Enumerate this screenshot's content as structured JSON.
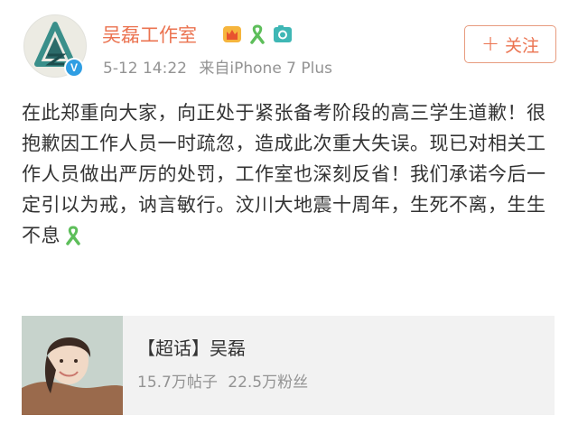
{
  "post": {
    "author": "吴磊工作室",
    "time": "5-12 14:22",
    "source": "来自iPhone 7 Plus",
    "follow_label": "关注",
    "follow_icon": "plus-icon",
    "content": "在此郑重向大家，向正处于紧张备考阶段的高三学生道歉！很抱歉因工作人员一时疏忽，造成此次重大失误。现已对相关工作人员做出严厉的处罚，工作室也深刻反省！我们承诺今后一定引以为戒，讷言敏行。汶川大地震十周年，生死不离，生生不息",
    "badges": [
      "crown-icon",
      "green-ribbon-icon",
      "camera-icon"
    ],
    "verified_mark": "V",
    "colors": {
      "accent": "#eb7350",
      "text": "#333333",
      "meta": "#939393",
      "verified": "#2f9ee3",
      "ribbon": "#5dbe5a"
    }
  },
  "card": {
    "title": "【超话】吴磊",
    "posts": "15.7万帖子",
    "fans": "22.5万粉丝"
  }
}
